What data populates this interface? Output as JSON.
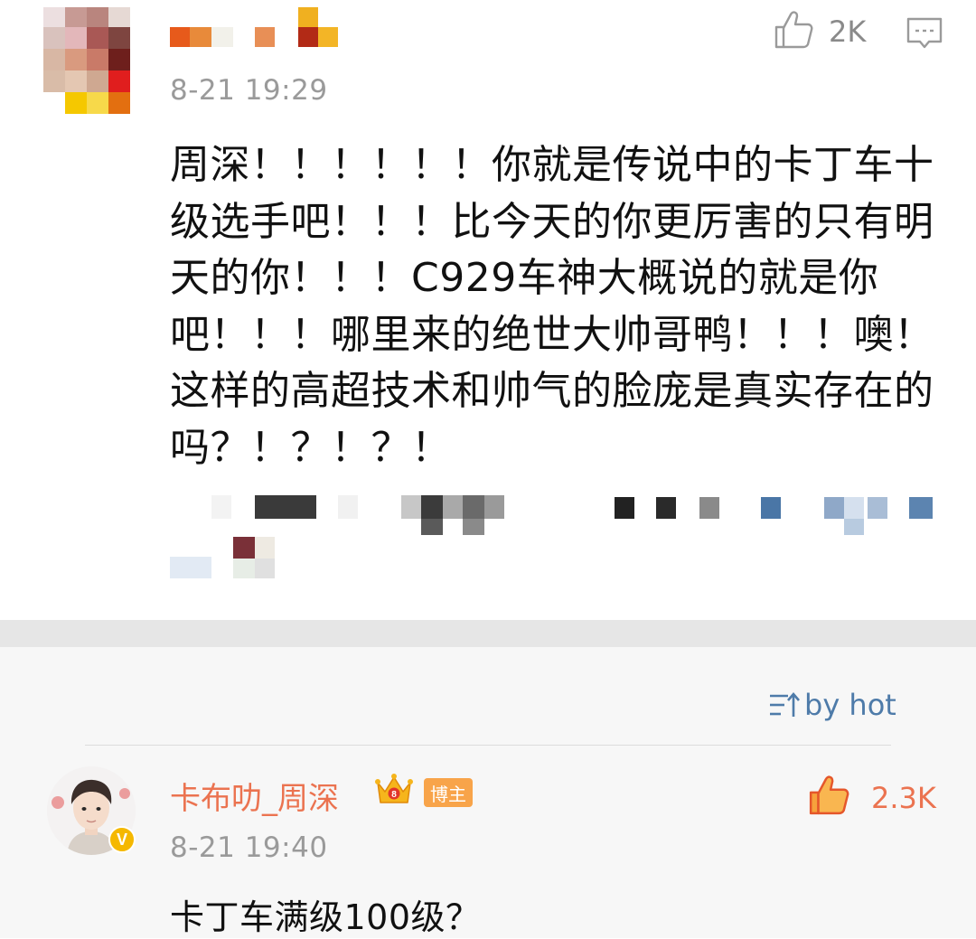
{
  "top_comment": {
    "time": "8-21 19:29",
    "like_count": "2K",
    "body": "周深！！！！！！你就是传说中的卡丁车十级选手吧！！！比今天的你更厉害的只有明天的你！！！C929车神大概说的就是你吧！！！哪里来的绝世大帅哥鸭！！！噢！这样的高超技术和帅气的脸庞是真实存在的吗？！？！？！"
  },
  "sort": {
    "label": "by hot"
  },
  "reply": {
    "username": "卡布叻_周深",
    "badge": "博主",
    "verified_mark": "V",
    "time": "8-21 19:40",
    "like_count": "2.3K",
    "text": "卡丁车满级100级？"
  },
  "colors": {
    "accent_orange": "#eb7350",
    "link_blue": "#4e7ba9",
    "muted_gray": "#9a9a9a"
  }
}
